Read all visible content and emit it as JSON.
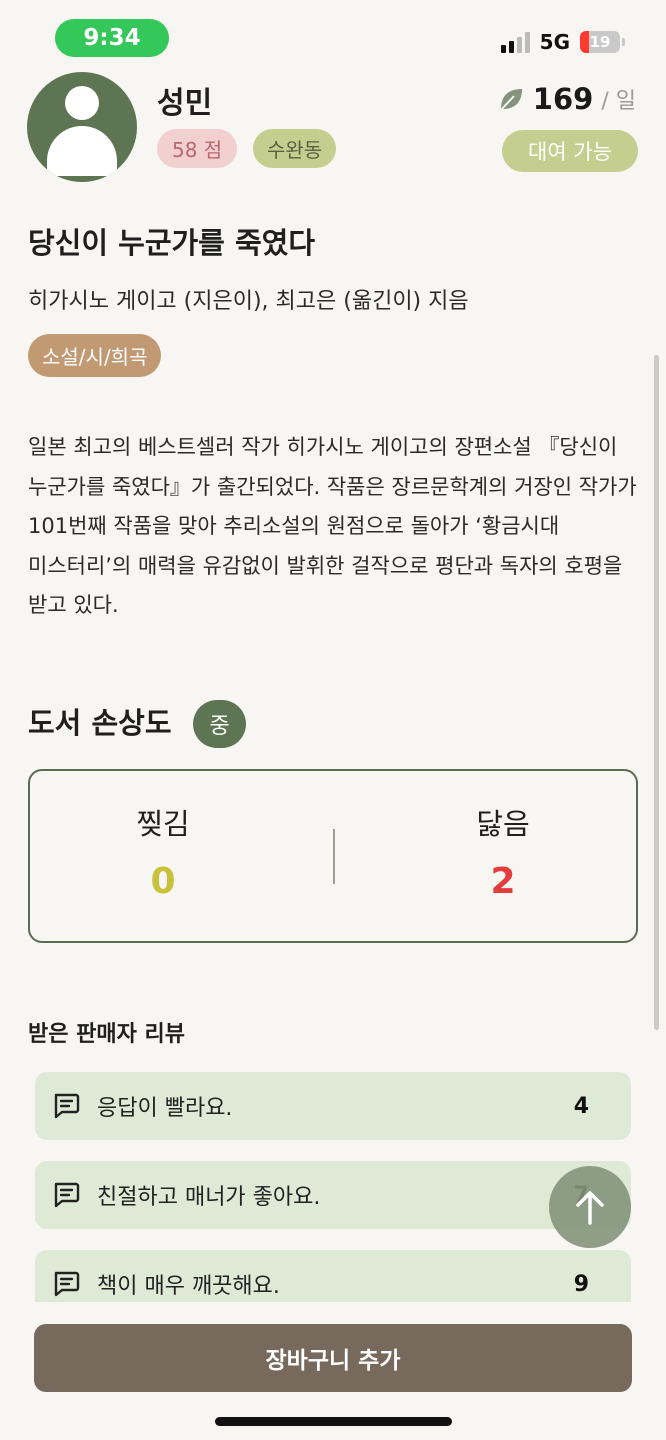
{
  "status_bar": {
    "time": "9:34",
    "network": "5G",
    "battery": "19"
  },
  "seller": {
    "name": "성민",
    "score": "58 점",
    "location": "수완동"
  },
  "price": {
    "amount": "169",
    "unit": "/ 일",
    "status": "대여 가능"
  },
  "book": {
    "title": "당신이 누군가를 죽였다",
    "authors": "히가시노 게이고 (지은이), 최고은 (옮긴이) 지음",
    "genre": "소설/시/희곡",
    "description": "일본 최고의 베스트셀러 작가 히가시노 게이고의 장편소설 『당신이 누군가를 죽였다』가 출간되었다. 작품은 장르문학계의 거장인 작가가 101번째 작품을 맞아 추리소설의 원점으로 돌아가 ‘황금시대 미스터리’의 매력을 유감없이 발휘한 걸작으로 평단과 독자의 호평을 받고 있다."
  },
  "damage": {
    "title": "도서 손상도",
    "level": "중",
    "torn_label": "찢김",
    "torn_value": "0",
    "worn_label": "닳음",
    "worn_value": "2"
  },
  "reviews": {
    "title": "받은 판매자 리뷰",
    "items": [
      {
        "text": "응답이 빨라요.",
        "count": "4"
      },
      {
        "text": "친절하고 매너가 좋아요.",
        "count": "7"
      },
      {
        "text": "책이 매우 깨끗해요.",
        "count": "9"
      }
    ]
  },
  "cart_button": "장바구니 추가",
  "colors": {
    "accent": "#5d7552",
    "brand_brown": "#77695c",
    "review_bg": "#deead6"
  },
  "icons": [
    "leaf-icon",
    "chat-bubble-icon",
    "arrow-up-icon",
    "user-avatar-icon"
  ]
}
